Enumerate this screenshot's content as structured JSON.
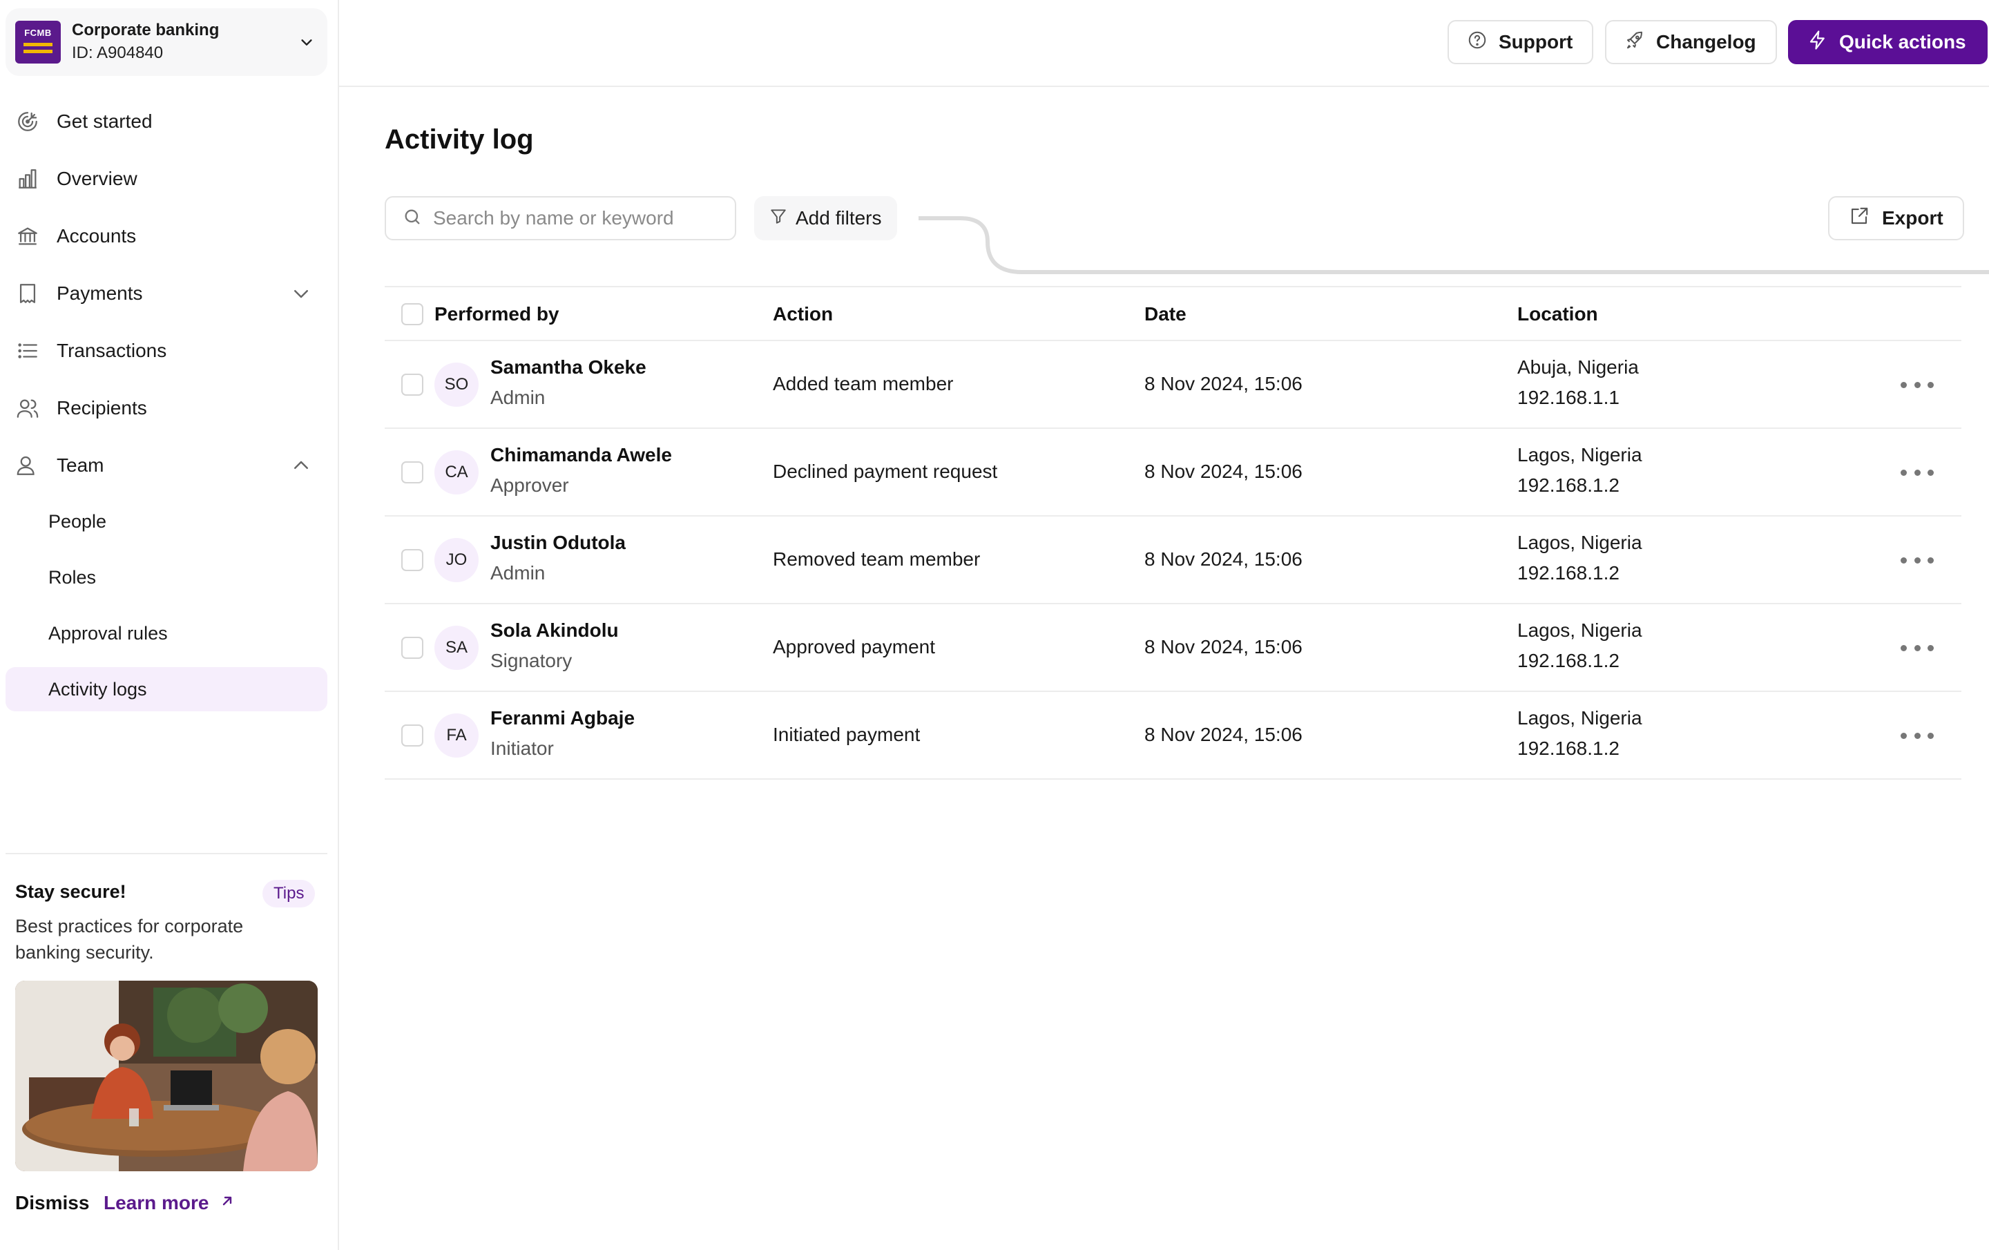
{
  "org": {
    "logo_text": "FCMB",
    "name": "Corporate banking",
    "id": "ID: A904840"
  },
  "nav": {
    "items": [
      {
        "label": "Get started",
        "icon": "target-icon"
      },
      {
        "label": "Overview",
        "icon": "bar-chart-icon"
      },
      {
        "label": "Accounts",
        "icon": "bank-icon"
      },
      {
        "label": "Payments",
        "icon": "receipt-icon"
      },
      {
        "label": "Transactions",
        "icon": "list-icon"
      },
      {
        "label": "Recipients",
        "icon": "users-icon"
      },
      {
        "label": "Team",
        "icon": "team-icon"
      }
    ],
    "team_sub": [
      {
        "label": "People"
      },
      {
        "label": "Roles"
      },
      {
        "label": "Approval rules"
      },
      {
        "label": "Activity logs",
        "active": true
      }
    ]
  },
  "tip": {
    "title": "Stay secure!",
    "badge": "Tips",
    "body": "Best practices for corporate banking security.",
    "dismiss": "Dismiss",
    "learn_more": "Learn more"
  },
  "topbar": {
    "support": "Support",
    "changelog": "Changelog",
    "quick_actions": "Quick actions"
  },
  "page": {
    "title": "Activity log",
    "search_placeholder": "Search by name or keyword",
    "add_filters": "Add filters",
    "export": "Export"
  },
  "table": {
    "headers": {
      "performed_by": "Performed by",
      "action": "Action",
      "date": "Date",
      "location": "Location"
    },
    "rows": [
      {
        "initials": "SO",
        "name": "Samantha Okeke",
        "role": "Admin",
        "action": "Added team member",
        "date": "8 Nov 2024, 15:06",
        "location": "Abuja, Nigeria",
        "ip": "192.168.1.1"
      },
      {
        "initials": "CA",
        "name": "Chimamanda Awele",
        "role": "Approver",
        "action": "Declined payment request",
        "date": "8 Nov 2024, 15:06",
        "location": "Lagos, Nigeria",
        "ip": "192.168.1.2"
      },
      {
        "initials": "JO",
        "name": "Justin Odutola",
        "role": "Admin",
        "action": "Removed team member",
        "date": "8 Nov 2024, 15:06",
        "location": "Lagos, Nigeria",
        "ip": "192.168.1.2"
      },
      {
        "initials": "SA",
        "name": "Sola Akindolu",
        "role": "Signatory",
        "action": "Approved payment",
        "date": "8 Nov 2024, 15:06",
        "location": "Lagos, Nigeria",
        "ip": "192.168.1.2"
      },
      {
        "initials": "FA",
        "name": "Feranmi Agbaje",
        "role": "Initiator",
        "action": "Initiated payment",
        "date": "8 Nov 2024, 15:06",
        "location": "Lagos, Nigeria",
        "ip": "192.168.1.2"
      }
    ]
  },
  "colors": {
    "brand": "#5b0f96",
    "active_bg": "#f6eefc",
    "border": "#ececec"
  }
}
